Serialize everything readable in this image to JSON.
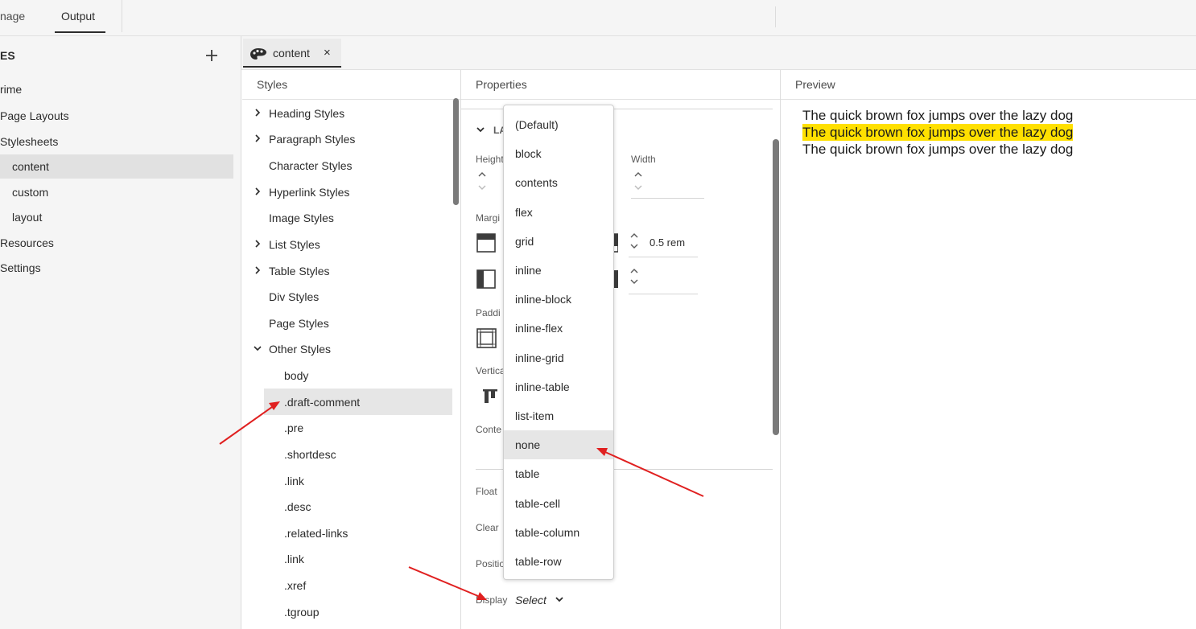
{
  "topbar": {
    "tab_manage": "nage",
    "tab_output": "Output"
  },
  "sidebar": {
    "title": "ES",
    "items": [
      {
        "label": "rime"
      },
      {
        "label": "Page Layouts"
      },
      {
        "label": "Stylesheets"
      },
      {
        "label": "content",
        "selected": true
      },
      {
        "label": "custom"
      },
      {
        "label": "layout"
      },
      {
        "label": "Resources"
      },
      {
        "label": "Settings"
      }
    ]
  },
  "editor_tab": {
    "label": "content",
    "close": "×"
  },
  "styles_panel": {
    "header": "Styles",
    "groups": [
      {
        "label": "Heading Styles",
        "expandable": true
      },
      {
        "label": "Paragraph Styles",
        "expandable": true
      },
      {
        "label": "Character Styles",
        "expandable": false
      },
      {
        "label": "Hyperlink Styles",
        "expandable": true
      },
      {
        "label": "Image Styles",
        "expandable": false
      },
      {
        "label": "List Styles",
        "expandable": true
      },
      {
        "label": "Table Styles",
        "expandable": true
      },
      {
        "label": "Div Styles",
        "expandable": false
      },
      {
        "label": "Page Styles",
        "expandable": false
      },
      {
        "label": "Other Styles",
        "expandable": true,
        "expanded": true
      }
    ],
    "other_styles": [
      "body",
      ".draft-comment",
      ".pre",
      ".shortdesc",
      ".link",
      ".desc",
      ".related-links",
      ".link",
      ".xref",
      ".tgroup"
    ],
    "selected": ".draft-comment"
  },
  "properties_panel": {
    "header": "Properties",
    "section": "LA",
    "height_label": "Height",
    "width_label": "Width",
    "margin_label": "Margi",
    "margin_value": "0.5 rem",
    "padding_label": "Paddi",
    "vertical_label": "Vertica",
    "content_label": "Conte",
    "float_label": "Float",
    "clear_label": "Clear",
    "position_label": "Positio",
    "display_label": "Display",
    "display_value": "Select"
  },
  "display_dropdown": {
    "options": [
      "(Default)",
      "block",
      "contents",
      "flex",
      "grid",
      "inline",
      "inline-block",
      "inline-flex",
      "inline-grid",
      "inline-table",
      "list-item",
      "none",
      "table",
      "table-cell",
      "table-column",
      "table-row"
    ],
    "hovered": "none"
  },
  "preview_panel": {
    "header": "Preview",
    "lines": [
      {
        "text": "The quick brown fox jumps over the lazy dog",
        "highlighted": false
      },
      {
        "text": "The quick brown fox jumps over the lazy dog",
        "highlighted": true
      },
      {
        "text": "The quick brown fox jumps over the lazy dog",
        "highlighted": false
      }
    ]
  },
  "colors": {
    "highlight": "#ffe000",
    "annotation_arrow": "#e02020",
    "selected_bg": "#e1e1e1"
  }
}
